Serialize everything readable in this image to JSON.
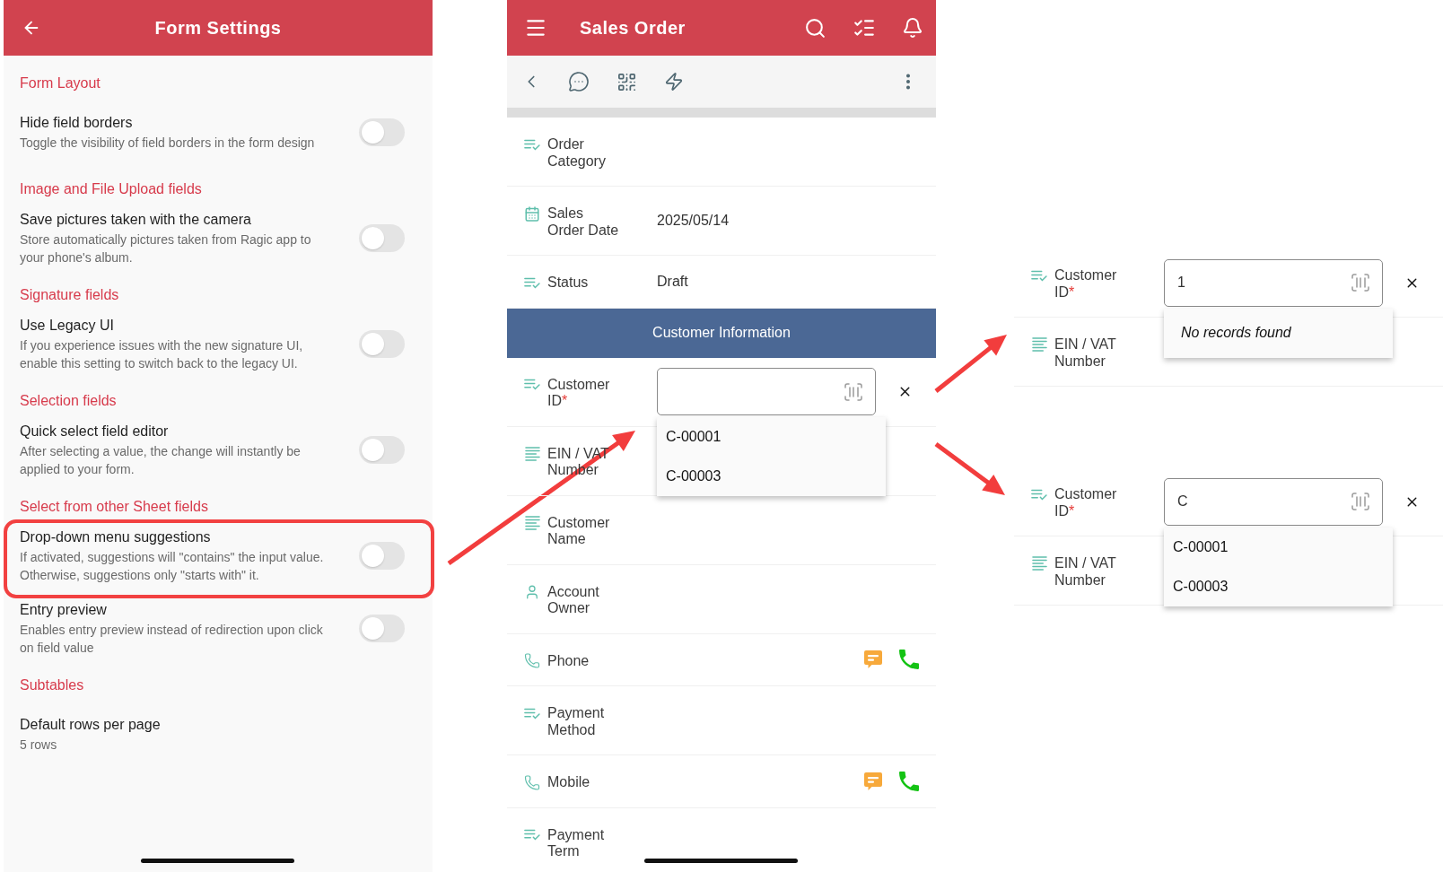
{
  "form_settings": {
    "title": "Form Settings",
    "sections": [
      {
        "heading": "Form Layout",
        "items": [
          {
            "kind": "toggle",
            "label": "Hide field borders",
            "description": "Toggle the visibility of field borders in the form design",
            "on": false
          }
        ]
      },
      {
        "heading": "Image and File Upload fields",
        "items": [
          {
            "kind": "toggle",
            "label": "Save pictures taken with the camera",
            "description": "Store automatically pictures taken from Ragic app to your phone's album.",
            "on": false
          }
        ]
      },
      {
        "heading": "Signature fields",
        "items": [
          {
            "kind": "toggle",
            "label": "Use Legacy UI",
            "description": "If you experience issues with the new signature UI, enable this setting to switch back to the legacy UI.",
            "on": false
          }
        ]
      },
      {
        "heading": "Selection fields",
        "items": [
          {
            "kind": "toggle",
            "label": "Quick select field editor",
            "description": "After selecting a value, the change will instantly be applied to your form.",
            "on": false
          }
        ]
      },
      {
        "heading": "Select from other Sheet fields",
        "items": [
          {
            "kind": "toggle",
            "label": "Drop-down menu suggestions",
            "description": "If activated, suggestions will \"contains\" the input value. Otherwise, suggestions only \"starts with\" it.",
            "on": false,
            "highlighted": true
          },
          {
            "kind": "toggle",
            "label": "Entry preview",
            "description": "Enables entry preview instead of redirection upon click on field value",
            "on": false
          }
        ]
      },
      {
        "heading": "Subtables",
        "items": [
          {
            "kind": "value",
            "label": "Default rows per page",
            "value": "5 rows"
          }
        ]
      }
    ]
  },
  "sales_order": {
    "title": "Sales Order",
    "rows": [
      {
        "kind": "select",
        "label": "Order Category"
      },
      {
        "kind": "date",
        "label": "Sales Order Date",
        "value": "2025/05/14"
      },
      {
        "kind": "select",
        "label": "Status",
        "value": "Draft"
      },
      {
        "kind": "section",
        "title": "Customer Information"
      },
      {
        "kind": "lookup",
        "label": "Customer ID",
        "required_mark": "*",
        "dropdown": [
          {
            "kind": "option",
            "text": "C-00001"
          },
          {
            "kind": "option",
            "text": "C-00003"
          }
        ]
      },
      {
        "kind": "text",
        "label": "EIN / VAT Number"
      },
      {
        "kind": "text",
        "label": "Customer Name"
      },
      {
        "kind": "user",
        "label": "Account Owner"
      },
      {
        "kind": "phone",
        "label": "Phone"
      },
      {
        "kind": "select",
        "label": "Payment Method"
      },
      {
        "kind": "phone",
        "label": "Mobile"
      },
      {
        "kind": "select",
        "label": "Payment Term"
      }
    ]
  },
  "lookup_examples": [
    {
      "rows": [
        {
          "kind": "lookup",
          "label": "Customer ID",
          "required_mark": "*",
          "value": "1",
          "dropdown": [
            {
              "kind": "message",
              "text": "No records found"
            }
          ]
        },
        {
          "kind": "text",
          "label": "EIN / VAT Number"
        }
      ]
    },
    {
      "rows": [
        {
          "kind": "lookup",
          "label": "Customer ID",
          "required_mark": "*",
          "value": "C",
          "dropdown": [
            {
              "kind": "option",
              "text": "C-00001"
            },
            {
              "kind": "option",
              "text": "C-00003"
            }
          ]
        },
        {
          "kind": "text",
          "label": "EIN / VAT Number"
        }
      ]
    }
  ]
}
